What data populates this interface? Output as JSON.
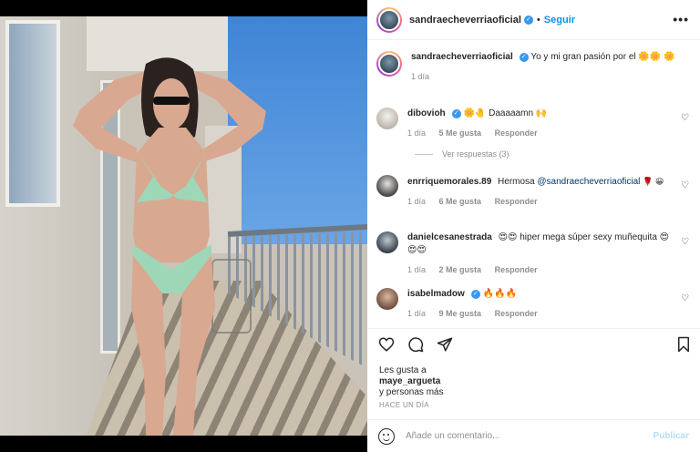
{
  "post_header": {
    "username": "sandraecheverriaoficial",
    "follow_label": "Seguir",
    "more_label": "•••"
  },
  "caption": {
    "username": "sandraecheverriaoficial",
    "text": "Yo y mi gran pasión por el 🌼🌼 🌼",
    "time": "1 día"
  },
  "comments": [
    {
      "username": "dibovioh",
      "text": "🌼🤚 Daaaaamn 🙌",
      "time": "1 día",
      "likes": "5 Me gusta",
      "reply": "Responder"
    },
    {
      "username": "enrriquemorales.89",
      "text": "Hermosa",
      "mention": "@sandraecheverriaoficial",
      "suffix": "🌹 😀",
      "time": "1 día",
      "likes": "6 Me gusta",
      "reply": "Responder"
    },
    {
      "username": "danielcesanestrada",
      "text": "😍😍 hiper mega súper sexy muñequita 😍😍😍",
      "time": "1 día",
      "likes": "2 Me gusta",
      "reply": "Responder"
    },
    {
      "username": "isabelmadow",
      "text": "🔥🔥🔥",
      "time": "1 día",
      "likes": "9 Me gusta",
      "reply": "Responder"
    }
  ],
  "view_replies": "Ver respuestas (3)",
  "likes_block": {
    "prefix": "Les gusta a",
    "user": "maye_argueta",
    "suffix": "y personas más"
  },
  "time_ago": "HACE UN DÍA",
  "composer": {
    "placeholder": "Añade un comentario...",
    "publish_label": "Publicar"
  },
  "icons": {
    "like": "heart-icon",
    "comment": "comment-icon",
    "share": "share-icon",
    "save": "bookmark-icon",
    "verified": "verified-badge-icon"
  },
  "colors": {
    "accent": "#0095f6",
    "verified": "#3897f0",
    "publish_disabled": "#b2dffc"
  }
}
